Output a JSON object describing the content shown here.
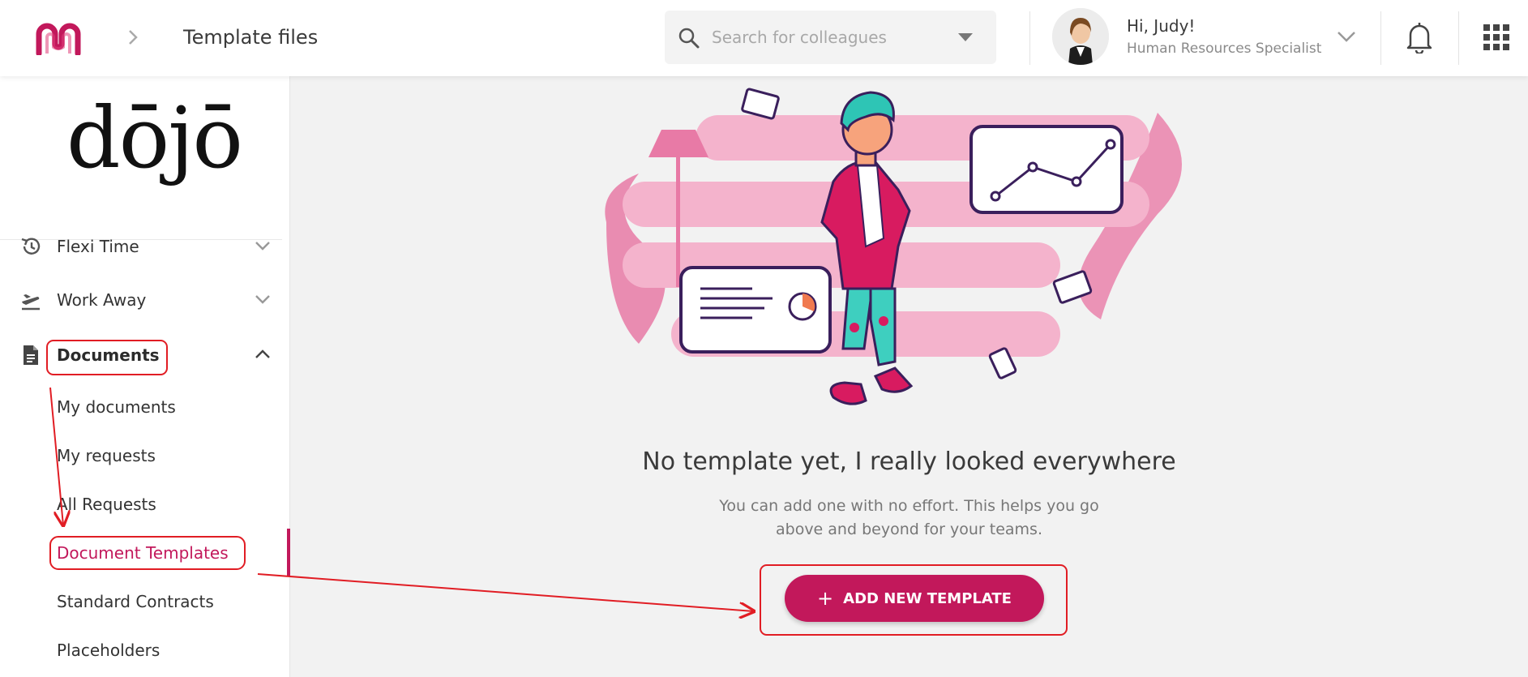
{
  "header": {
    "title": "Template files",
    "search": {
      "placeholder": "Search for colleagues"
    },
    "user": {
      "greeting": "Hi, Judy!",
      "role": "Human Resources Specialist"
    }
  },
  "sidebar": {
    "brand": "dōjō",
    "items": [
      {
        "label": "Flexi Time"
      },
      {
        "label": "Work Away"
      },
      {
        "label": "Documents"
      }
    ],
    "documents_sub": [
      {
        "label": "My documents"
      },
      {
        "label": "My requests"
      },
      {
        "label": "All Requests"
      },
      {
        "label": "Document Templates"
      },
      {
        "label": "Standard Contracts"
      },
      {
        "label": "Placeholders"
      }
    ]
  },
  "main": {
    "empty_title": "No template yet, I really looked everywhere",
    "empty_sub_line1": "You can add one with no effort. This helps you go",
    "empty_sub_line2": "above and beyond for your teams.",
    "add_button": "ADD NEW TEMPLATE",
    "add_button_icon": "+"
  },
  "colors": {
    "accent": "#c2185b",
    "annotation": "#e11d24"
  }
}
